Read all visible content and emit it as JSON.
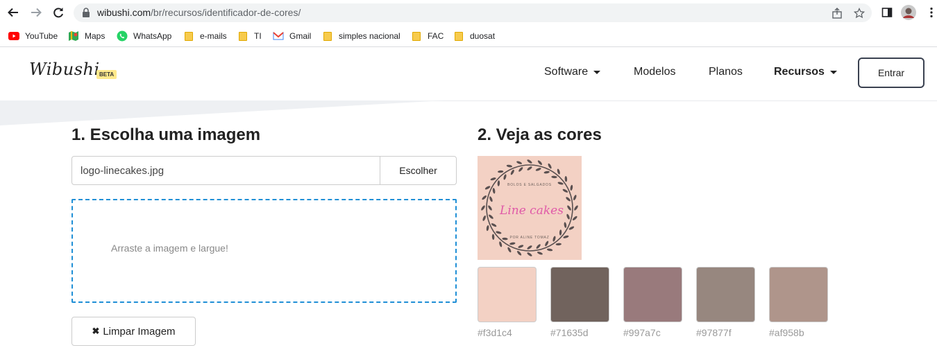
{
  "browser": {
    "url_host": "wibushi.com",
    "url_path": "/br/recursos/identificador-de-cores/",
    "bookmarks": [
      {
        "label": "YouTube",
        "icon": "youtube-icon"
      },
      {
        "label": "Maps",
        "icon": "maps-icon"
      },
      {
        "label": "WhatsApp",
        "icon": "whatsapp-icon"
      },
      {
        "label": "e-mails",
        "icon": "folder-icon"
      },
      {
        "label": "TI",
        "icon": "folder-icon"
      },
      {
        "label": "Gmail",
        "icon": "gmail-icon"
      },
      {
        "label": "simples nacional",
        "icon": "folder-icon"
      },
      {
        "label": "FAC",
        "icon": "folder-icon"
      },
      {
        "label": "duosat",
        "icon": "folder-icon"
      }
    ]
  },
  "site": {
    "logo": "Wibushi",
    "beta": "BETA",
    "nav": [
      {
        "label": "Software"
      },
      {
        "label": "Modelos"
      },
      {
        "label": "Planos"
      },
      {
        "label": "Recursos"
      }
    ],
    "login": "Entrar"
  },
  "left": {
    "title": "1. Escolha uma imagem",
    "file_value": "logo-linecakes.jpg",
    "choose": "Escolher",
    "drop_text": "Arraste a imagem e largue!",
    "clear_icon": "✖",
    "clear": "Limpar Imagem"
  },
  "right": {
    "title": "2. Veja as cores",
    "image": {
      "top_text": "BOLOS E SALGADOS",
      "script_text": "Line cakes",
      "bottom_text": "POR ALINE TOMAZ",
      "bg": "#f3d1c4",
      "script_color": "#e05aa8",
      "leaf_color": "#5a5050"
    },
    "swatches": [
      {
        "hex": "#f3d1c4"
      },
      {
        "hex": "#71635d"
      },
      {
        "hex": "#997a7c"
      },
      {
        "hex": "#97877f"
      },
      {
        "hex": "#af958b"
      }
    ]
  }
}
